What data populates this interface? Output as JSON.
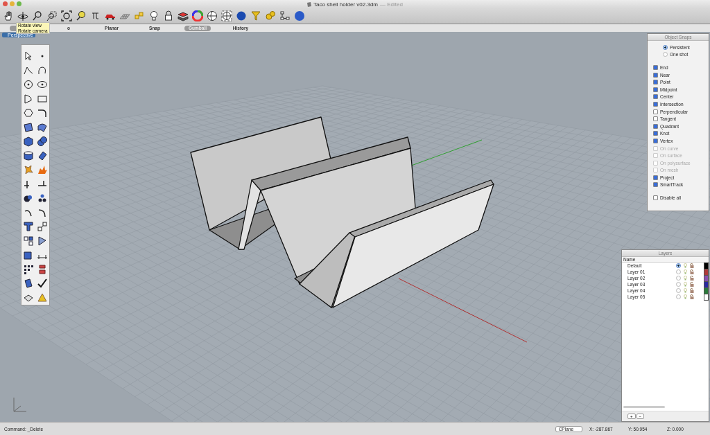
{
  "window": {
    "title": "Taco shell holder v02.3dm",
    "edit_state": "— Edited"
  },
  "tooltip": {
    "lines": [
      "Rotate view",
      "Rotate camera"
    ]
  },
  "tabs": [
    {
      "selected": true
    },
    {
      "label": "o",
      "selected": false
    },
    {
      "label": "Planar",
      "selected": false
    },
    {
      "label": "Snap",
      "selected": false
    },
    {
      "label": "Gumball",
      "selected": true
    },
    {
      "label": "History",
      "selected": false
    }
  ],
  "viewport": {
    "title": "Perspective"
  },
  "object_snaps": {
    "title": "Object Snaps",
    "modes": [
      {
        "label": "Persistent",
        "selected": true
      },
      {
        "label": "One shot",
        "selected": false
      }
    ],
    "snaps": [
      {
        "label": "End",
        "checked": true,
        "disabled": false
      },
      {
        "label": "Near",
        "checked": true,
        "disabled": false
      },
      {
        "label": "Point",
        "checked": true,
        "disabled": false
      },
      {
        "label": "Midpoint",
        "checked": true,
        "disabled": false
      },
      {
        "label": "Center",
        "checked": true,
        "disabled": false
      },
      {
        "label": "Intersection",
        "checked": true,
        "disabled": false
      },
      {
        "label": "Perpendicular",
        "checked": false,
        "disabled": false
      },
      {
        "label": "Tangent",
        "checked": false,
        "disabled": false
      },
      {
        "label": "Quadrant",
        "checked": true,
        "disabled": false
      },
      {
        "label": "Knot",
        "checked": true,
        "disabled": false
      },
      {
        "label": "Vertex",
        "checked": true,
        "disabled": false
      },
      {
        "label": "On curve",
        "checked": false,
        "disabled": true
      },
      {
        "label": "On surface",
        "checked": false,
        "disabled": true
      },
      {
        "label": "On polysurface",
        "checked": false,
        "disabled": true
      },
      {
        "label": "On mesh",
        "checked": false,
        "disabled": true
      },
      {
        "label": "Project",
        "checked": true,
        "disabled": false
      },
      {
        "label": "SmartTrack",
        "checked": true,
        "disabled": false
      }
    ],
    "disable_all": {
      "label": "Disable all",
      "checked": false
    }
  },
  "layers": {
    "title": "Layers",
    "column": "Name",
    "rows": [
      {
        "name": "Default",
        "selected": true,
        "color": "#000000"
      },
      {
        "name": "Layer 01",
        "selected": false,
        "color": "#b03a3a"
      },
      {
        "name": "Layer 02",
        "selected": false,
        "color": "#8a4fb0"
      },
      {
        "name": "Layer 03",
        "selected": false,
        "color": "#2a2aa0"
      },
      {
        "name": "Layer 04",
        "selected": false,
        "color": "#2a7a3a"
      },
      {
        "name": "Layer 05",
        "selected": false,
        "color": "#ffffff"
      }
    ],
    "buttons": [
      "+",
      "−"
    ]
  },
  "status_bar": {
    "command": "Command:  _Delete",
    "cplane": "CPlane",
    "x": "X: -287.867",
    "y": "Y: 50.954",
    "z": "Z: 0.000"
  }
}
